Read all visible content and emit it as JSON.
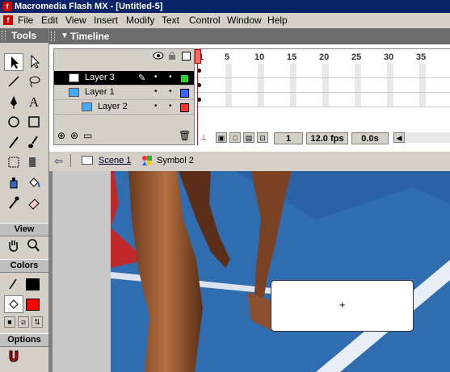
{
  "window": {
    "title": "Macromedia Flash MX - [Untitled-5]"
  },
  "menu": [
    "File",
    "Edit",
    "View",
    "Insert",
    "Modify",
    "Text",
    "Control",
    "Window",
    "Help"
  ],
  "tools_panel": {
    "title": "Tools",
    "view_label": "View",
    "colors_label": "Colors",
    "options_label": "Options",
    "stroke_color": "#000000",
    "fill_color": "#ff0000"
  },
  "timeline": {
    "title": "Timeline",
    "layers": [
      {
        "name": "Layer 3",
        "selected": true,
        "color": "#33cc33"
      },
      {
        "name": "Layer 1",
        "selected": false,
        "color": "#3366ff"
      },
      {
        "name": "Layer 2",
        "selected": false,
        "color": "#ff3333"
      }
    ],
    "frame_numbers": [
      "1",
      "5",
      "10",
      "15",
      "20",
      "25",
      "30",
      "35"
    ],
    "current_frame": "1",
    "frame_rate": "12.0 fps",
    "elapsed_time": "0.0s"
  },
  "edit_bar": {
    "scene": "Scene 1",
    "symbol": "Symbol 2"
  }
}
